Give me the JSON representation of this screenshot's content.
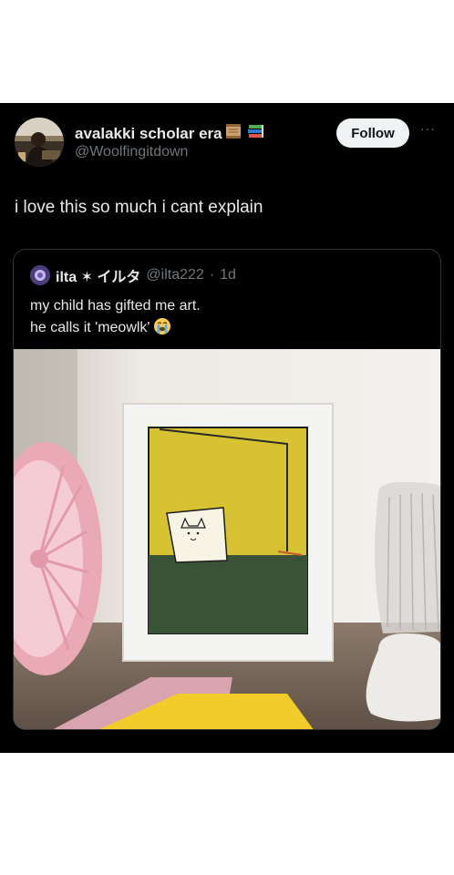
{
  "author": {
    "display_name": "avalakki scholar era",
    "handle": "@Woolfingitdown"
  },
  "actions": {
    "follow_label": "Follow",
    "more_label": "···"
  },
  "tweet": {
    "text": "i love this so much i cant explain"
  },
  "quoted": {
    "display_name": "ilta ✶ イルタ",
    "handle": "@ilta222",
    "separator": "·",
    "time": "1d",
    "text_line1": "my child has gifted me art.",
    "text_line2": "he calls it 'meowlk'"
  },
  "colors": {
    "background": "#000000",
    "text": "#e7e9ea",
    "muted": "#71767b",
    "follow_bg": "#eff3f4",
    "border": "#2f3336"
  },
  "icons": [
    "scroll-icon",
    "books-icon",
    "more-icon",
    "sob-emoji-icon"
  ]
}
